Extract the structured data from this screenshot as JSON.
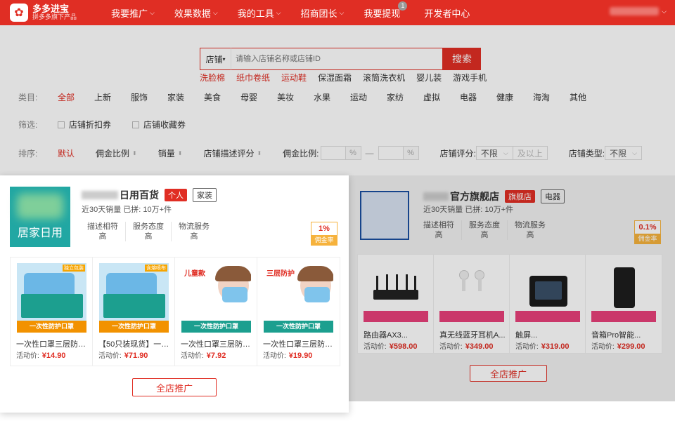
{
  "header": {
    "logo_title": "多多进宝",
    "logo_sub": "拼多多旗下产品",
    "nav": [
      {
        "label": "我要推广"
      },
      {
        "label": "效果数据"
      },
      {
        "label": "我的工具"
      },
      {
        "label": "招商团长"
      },
      {
        "label": "我要提现",
        "badge": "1"
      },
      {
        "label": "开发者中心"
      }
    ]
  },
  "search": {
    "scope": "店铺",
    "placeholder": "请输入店铺名称或店铺ID",
    "button": "搜索",
    "hotwords": [
      "洗脸棉",
      "纸巾卷纸",
      "运动鞋",
      "保湿面霜",
      "滚筒洗衣机",
      "婴儿装",
      "游戏手机"
    ]
  },
  "filters": {
    "category_label": "类目:",
    "categories": [
      "全部",
      "上新",
      "服饰",
      "家装",
      "美食",
      "母婴",
      "美妆",
      "水果",
      "运动",
      "家纺",
      "虚拟",
      "电器",
      "健康",
      "海淘",
      "其他"
    ],
    "screen_label": "筛选:",
    "checks": [
      "店铺折扣券",
      "店铺收藏券"
    ],
    "sort_label": "排序:",
    "sorts": [
      "默认",
      "佣金比例",
      "销量",
      "店铺描述评分"
    ],
    "commission_label": "佣金比例:",
    "pct": "%",
    "dash": "—",
    "store_score_label": "店铺评分:",
    "store_score_value": "不限",
    "store_score_note": "及以上",
    "store_type_label": "店铺类型:",
    "store_type_value": "不限"
  },
  "store1": {
    "logo_text": "居家日用",
    "name": "日用百货",
    "tag1": "个人",
    "tag2": "家装",
    "meta": "近30天销量 已拼: 10万+件",
    "scores": [
      {
        "label": "描述相符",
        "value": "高"
      },
      {
        "label": "服务态度",
        "value": "高"
      },
      {
        "label": "物流服务",
        "value": "高"
      }
    ],
    "rate": "1%",
    "rate_label": "佣金率",
    "products": [
      {
        "title": "一次性口罩三层防护...",
        "price_label": "活动价:",
        "price": "¥14.90",
        "img_band": "一次性防护口罩",
        "img_corner": "独立包装",
        "kid": false
      },
      {
        "title": "【50只装现货】一次...",
        "price_label": "活动价:",
        "price": "¥71.90",
        "img_band": "一次性防护口罩",
        "img_corner": "含熔喷布",
        "kid": false
      },
      {
        "title": "一次性口罩三层防护...",
        "price_label": "活动价:",
        "price": "¥7.92",
        "img_band": "一次性防护口罩",
        "img_corner": "儿童款",
        "kid": true
      },
      {
        "title": "一次性口罩三层防护...",
        "price_label": "活动价:",
        "price": "¥19.90",
        "img_band": "一次性防护口罩",
        "img_corner": "三层防护",
        "kid": true
      }
    ],
    "all_button": "全店推广"
  },
  "store2": {
    "name": "官方旗舰店",
    "tag1": "旗舰店",
    "tag2": "电器",
    "meta": "近30天销量 已拼: 10万+件",
    "scores": [
      {
        "label": "描述相符",
        "value": "高"
      },
      {
        "label": "服务态度",
        "value": "高"
      },
      {
        "label": "物流服务",
        "value": "高"
      }
    ],
    "rate": "0.1%",
    "rate_label": "佣金率",
    "products": [
      {
        "title": "路由器AX3...",
        "price_label": "活动价:",
        "price": "¥598.00"
      },
      {
        "title": "真无线蓝牙耳机A...",
        "price_label": "活动价:",
        "price": "¥349.00"
      },
      {
        "title": "触屏...",
        "price_label": "活动价:",
        "price": "¥319.00"
      },
      {
        "title": "音箱Pro智能...",
        "price_label": "活动价:",
        "price": "¥299.00"
      }
    ],
    "all_button": "全店推广"
  },
  "colors": {
    "brand": "#e02e24",
    "rate_badge": "#f6b23c",
    "mask_green": "#1c9f8f"
  }
}
